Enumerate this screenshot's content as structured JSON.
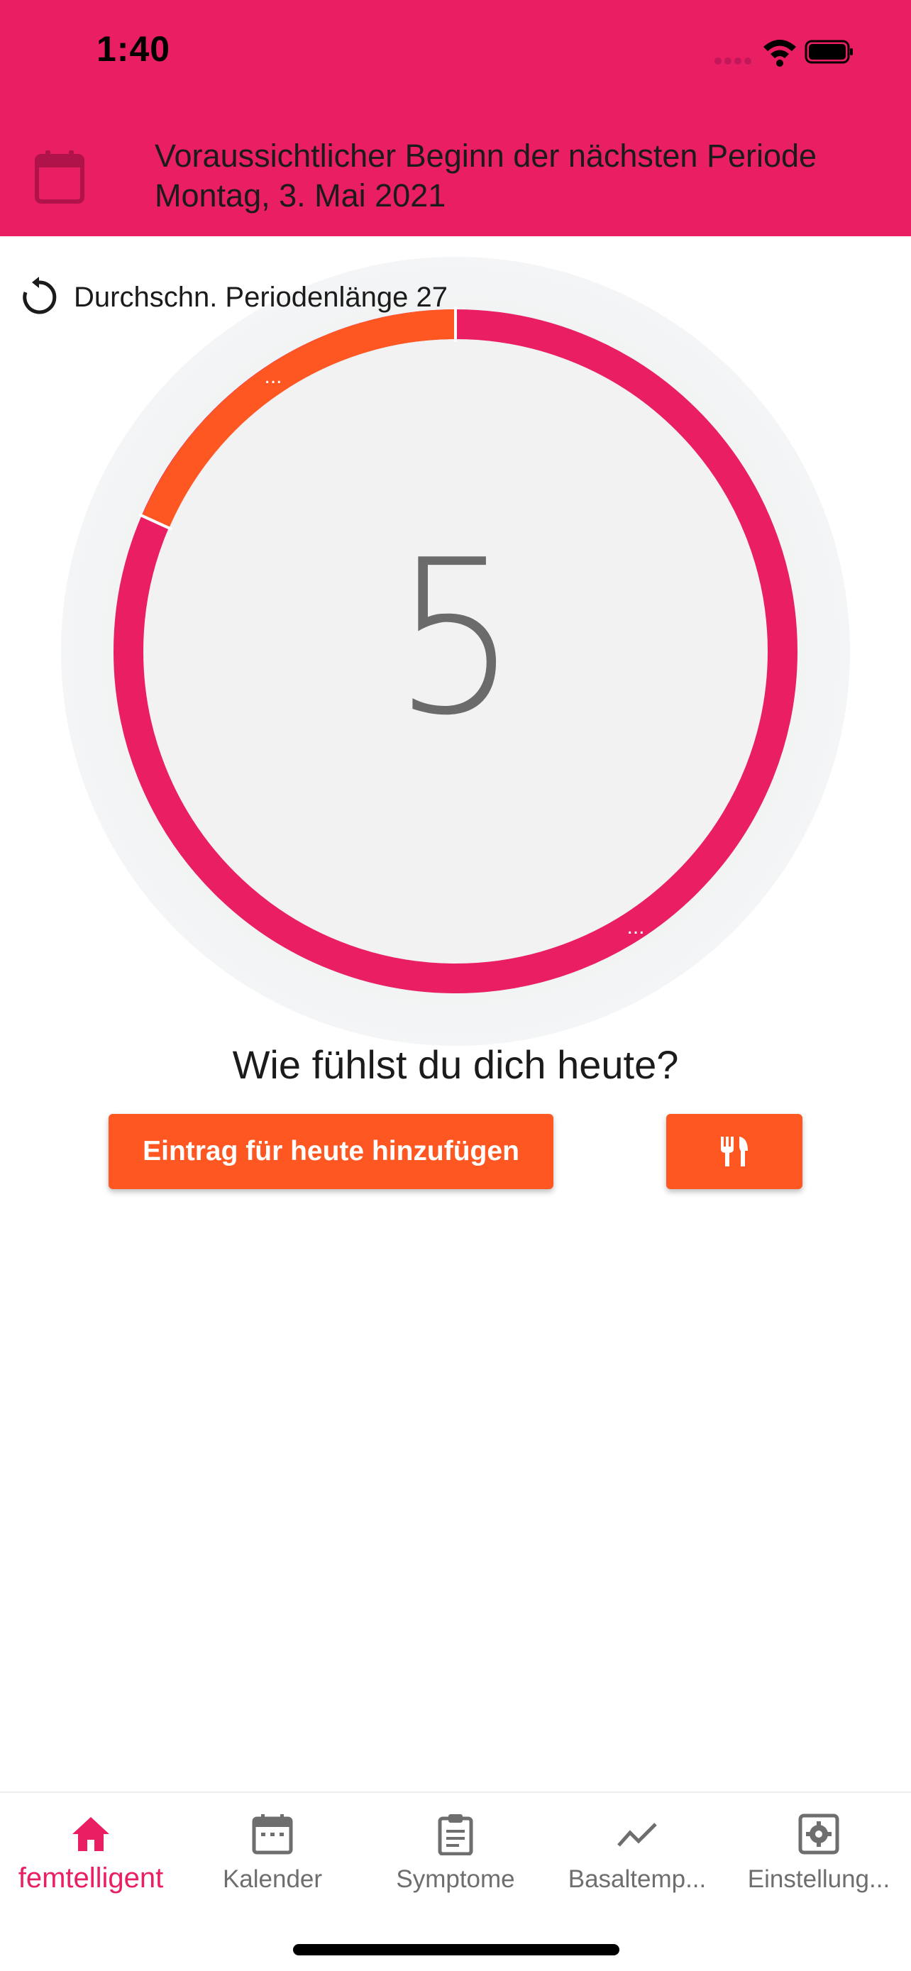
{
  "status_bar": {
    "time": "1:40"
  },
  "header": {
    "next_period_text": "Voraussichtlicher Beginn der nächsten Periode Montag, 3. Mai 2021"
  },
  "cycle": {
    "average_label": "Durchschn. Periodenlänge 27",
    "current_day": "5",
    "phase_markers": [
      "...",
      "..."
    ]
  },
  "prompt": {
    "question": "Wie fühlst du dich heute?"
  },
  "actions": {
    "add_entry_label": "Eintrag für heute hinzufügen"
  },
  "nav": {
    "items": [
      {
        "label": "femtelligent",
        "icon": "home-icon",
        "active": true
      },
      {
        "label": "Kalender",
        "icon": "calendar-icon",
        "active": false
      },
      {
        "label": "Symptome",
        "icon": "clipboard-icon",
        "active": false
      },
      {
        "label": "Basaltemp...",
        "icon": "trend-icon",
        "active": false
      },
      {
        "label": "Einstellung...",
        "icon": "settings-icon",
        "active": false
      }
    ]
  },
  "colors": {
    "primary": "#e91e63",
    "accent": "#ff5722"
  }
}
